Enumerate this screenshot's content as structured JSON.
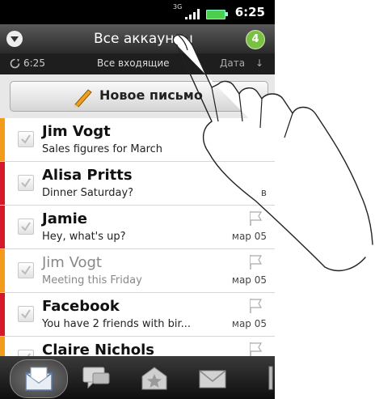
{
  "status_bar": {
    "network": "3G",
    "time": "6:25"
  },
  "header": {
    "title": "Все аккаунты",
    "unread_count": "4"
  },
  "subheader": {
    "sync_time": "6:25",
    "folder": "Все входящие",
    "sort_label": "Дата",
    "sort_arrow": "↓"
  },
  "compose": {
    "label": "Новое письмо"
  },
  "messages": [
    {
      "sender": "Jim Vogt",
      "subject": "Sales figures for March",
      "date": "",
      "read": false,
      "stripe_color": "#f39c1c"
    },
    {
      "sender": "Alisa Pritts",
      "subject": "Dinner Saturday?",
      "date": "в",
      "read": false,
      "stripe_color": "#d4192a"
    },
    {
      "sender": "Jamie",
      "subject": "Hey, what's up?",
      "date": "мар 05",
      "read": false,
      "stripe_color": "#d4192a"
    },
    {
      "sender": "Jim Vogt",
      "subject": "Meeting this Friday",
      "date": "мар 05",
      "read": true,
      "stripe_color": "#f39c1c"
    },
    {
      "sender": "Facebook",
      "subject": "You have 2 friends with bir...",
      "date": "мар 05",
      "read": false,
      "stripe_color": "#d4192a"
    },
    {
      "sender": "Claire Nichols",
      "subject": "",
      "date": "",
      "read": false,
      "stripe_color": "#f39c1c"
    }
  ],
  "bottom_tabs": [
    {
      "icon": "inbox-envelope-icon",
      "selected": true
    },
    {
      "icon": "conversations-icon",
      "selected": false
    },
    {
      "icon": "favorites-star-icon",
      "selected": false
    },
    {
      "icon": "unread-mail-icon",
      "selected": false
    },
    {
      "icon": "flagged-icon",
      "selected": false
    }
  ],
  "colors": {
    "accent_green": "#7ac143",
    "stripe_orange": "#f39c1c",
    "stripe_red": "#d4192a"
  }
}
